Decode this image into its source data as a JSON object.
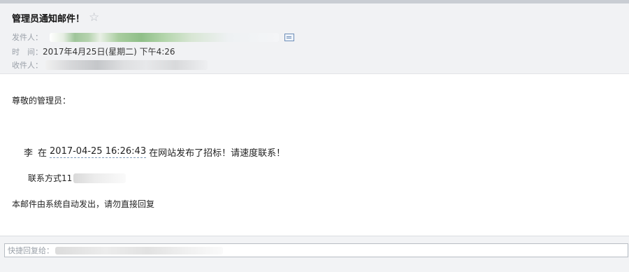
{
  "header": {
    "subject": "管理员通知邮件！",
    "star_icon": "☆",
    "from_label": "发件人：",
    "time_label": "时　间：",
    "time_value": "2017年4月25日(星期二) 下午4:26",
    "to_label": "收件人："
  },
  "body": {
    "greeting": "尊敬的管理员：",
    "notice_name": "李",
    "notice_prefix": "在",
    "notice_datetime": "2017-04-25 16:26:43",
    "notice_suffix": "在网站发布了招标！请速度联系！",
    "contact_label": "联系方式11",
    "footer": "本邮件由系统自动发出，请勿直接回复"
  },
  "reply": {
    "label": "快捷回复给："
  },
  "colors": {
    "header_bg": "#f1f2f4",
    "link_accent": "#6f8fb8"
  }
}
